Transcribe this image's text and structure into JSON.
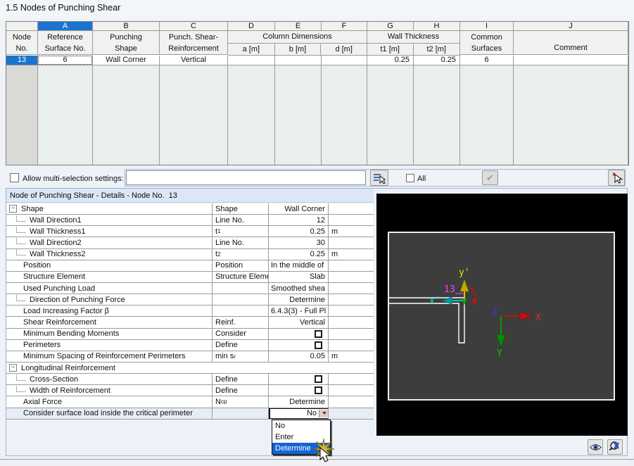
{
  "title": "1.5 Nodes of Punching Shear",
  "main_table": {
    "letters": [
      "A",
      "B",
      "C",
      "D",
      "E",
      "F",
      "G",
      "H",
      "I",
      "J"
    ],
    "node_header": [
      "Node",
      "No."
    ],
    "col_a": [
      "Reference",
      "Surface No."
    ],
    "col_b": [
      "Punching",
      "Shape"
    ],
    "col_c": [
      "Punch. Shear-",
      "Reinforcement"
    ],
    "group_dims": {
      "label": "Column Dimensions",
      "subs": [
        "a [m]",
        "b [m]",
        "d [m]"
      ]
    },
    "group_wall": {
      "label": "Wall Thickness",
      "subs": [
        "t1 [m]",
        "t2 [m]"
      ]
    },
    "col_i": [
      "Common",
      "Surfaces"
    ],
    "col_j": "Comment",
    "row": {
      "node": "13",
      "ref_surface": "6",
      "shape": "Wall Corner",
      "reinforcement": "Vertical",
      "a": "",
      "b": "",
      "d": "",
      "t1": "0.25",
      "t2": "0.25",
      "common": "6",
      "comment": ""
    }
  },
  "toolbar": {
    "multi_select_label": "Allow multi-selection settings:",
    "field_value": "",
    "all_label": "All",
    "check_glyph": "✔"
  },
  "details": {
    "header": "Node of Punching Shear - Details - Node No.  13",
    "rows": [
      {
        "type": "group",
        "label": "Shape",
        "param": "Shape",
        "value": "Wall Corner",
        "unit": "",
        "value_kind": "text",
        "align": "right"
      },
      {
        "type": "child",
        "label": "Wall Direction1",
        "param": "Line No.",
        "value": "12",
        "unit": "",
        "value_kind": "text",
        "align": "right"
      },
      {
        "type": "child",
        "label": "Wall Thickness1",
        "param": "t",
        "param_sub": "1",
        "value": "0.25",
        "unit": "m",
        "value_kind": "text",
        "align": "right"
      },
      {
        "type": "child",
        "label": "Wall Direction2",
        "param": "Line No.",
        "value": "30",
        "unit": "",
        "value_kind": "text",
        "align": "right"
      },
      {
        "type": "child",
        "label": "Wall Thickness2",
        "param": "t",
        "param_sub": "2",
        "value": "0.25",
        "unit": "m",
        "value_kind": "text",
        "align": "right"
      },
      {
        "type": "item",
        "label": "Position",
        "param": "Position",
        "value": "In the middle of",
        "unit": "",
        "value_kind": "text",
        "align": "left"
      },
      {
        "type": "item",
        "label": "Structure Element",
        "param": "Structure Eleme",
        "value": "Slab",
        "unit": "",
        "value_kind": "text",
        "align": "right"
      },
      {
        "type": "item",
        "label": "Used Punching Load",
        "param": "",
        "value": "Smoothed shea",
        "unit": "",
        "value_kind": "text",
        "align": "left"
      },
      {
        "type": "child",
        "label": "Direction of Punching Force",
        "param": "",
        "value": "Determine",
        "unit": "",
        "value_kind": "text",
        "align": "right"
      },
      {
        "type": "item",
        "label": "Load Increasing Factor β",
        "param": "",
        "value": "6.4.3(3) - Full Pl",
        "unit": "",
        "value_kind": "text",
        "align": "left"
      },
      {
        "type": "item",
        "label": "Shear Reinforcement",
        "param": "Reinf.",
        "value": "Vertical",
        "unit": "",
        "value_kind": "text",
        "align": "right"
      },
      {
        "type": "item",
        "label": "Minimum Bending Moments",
        "param": "Consider",
        "value": "",
        "unit": "",
        "value_kind": "check",
        "align": "right"
      },
      {
        "type": "item",
        "label": "Perimeters",
        "param": "Define",
        "value": "",
        "unit": "",
        "value_kind": "check",
        "align": "right"
      },
      {
        "type": "item",
        "label": "Minimum Spacing of Reinforcement Perimeters",
        "param": "min s",
        "param_sub": "r",
        "value": "0.05",
        "unit": "m",
        "value_kind": "text",
        "align": "right"
      },
      {
        "type": "group_full",
        "label": "Longitudinal Reinforcement",
        "param": "",
        "value": "",
        "unit": "",
        "value_kind": "none",
        "align": "right"
      },
      {
        "type": "child",
        "label": "Cross-Section",
        "param": "Define",
        "value": "",
        "unit": "",
        "value_kind": "check",
        "align": "right"
      },
      {
        "type": "child",
        "label": "Width of Reinforcement",
        "param": "Define",
        "value": "",
        "unit": "",
        "value_kind": "check",
        "align": "right"
      },
      {
        "type": "item",
        "label": "Axial Force",
        "param": "N",
        "param_sub": "cp",
        "value": "Determine",
        "unit": "",
        "value_kind": "text",
        "align": "right"
      },
      {
        "type": "item",
        "label": "Consider surface load inside the critical perimeter",
        "param": "",
        "value": "",
        "unit": "",
        "value_kind": "combo",
        "align": "right",
        "focused": true
      }
    ]
  },
  "combo": {
    "value": "No"
  },
  "dropdown": {
    "options": [
      "No",
      "Enter",
      "Determine"
    ],
    "highlighted_index": 2
  },
  "graphics": {
    "node_label": "13",
    "local_axis_x": "x'",
    "local_axis_y": "y'",
    "global_axis_x": "X",
    "global_axis_y": "Y",
    "global_axis_z": "Z"
  },
  "icons": {
    "collapse": "−"
  },
  "colors": {
    "selection": "#1b75cf",
    "dropdown_highlight": "#1464d2",
    "canvas_bg": "#000000",
    "slab": "#3d3d3d"
  }
}
